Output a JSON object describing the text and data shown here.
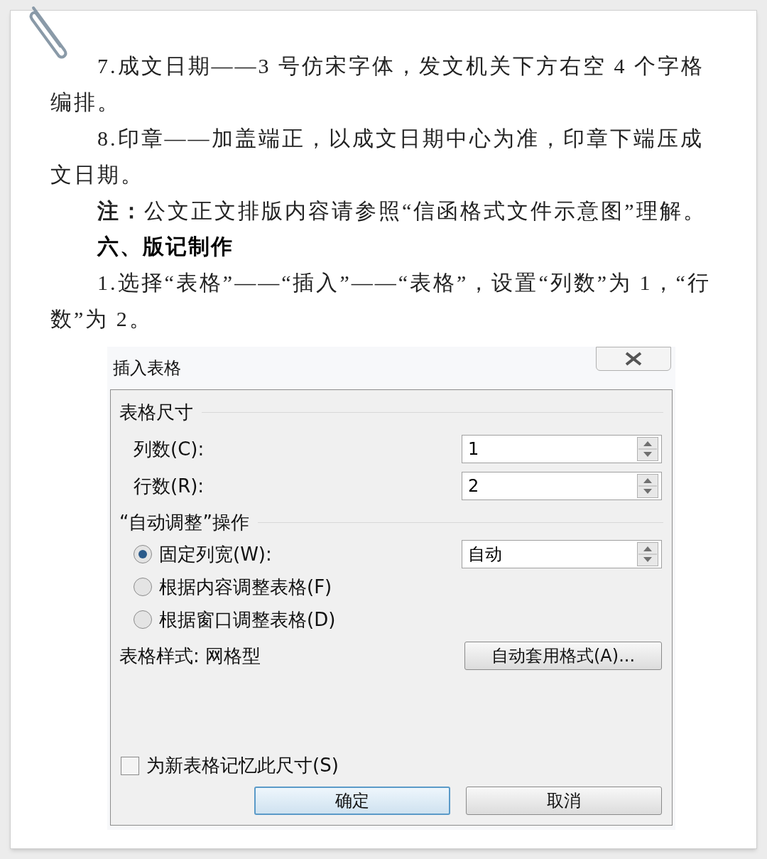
{
  "paragraphs": [
    {
      "kind": "body",
      "text": "7.成文日期——3 号仿宋字体，发文机关下方右空 4 个字格编排。"
    },
    {
      "kind": "body",
      "text": "8.印章——加盖端正，以成文日期中心为准，印章下端压成文日期。"
    },
    {
      "kind": "body",
      "text": "**注：**公文正文排版内容请参照“信函格式文件示意图”理解。"
    },
    {
      "kind": "heading",
      "text": "六、版记制作"
    },
    {
      "kind": "body",
      "text": "1.选择“表格”——“插入”——“表格”，设置“列数”为 1，“行数”为 2。"
    }
  ],
  "dialog": {
    "title": "插入表格",
    "size_group": {
      "title": "表格尺寸",
      "fields": [
        {
          "label": "列数(C):",
          "value": "1"
        },
        {
          "label": "行数(R):",
          "value": "2"
        }
      ]
    },
    "autofit_group": {
      "title": "“自动调整”操作",
      "options": [
        {
          "label": "固定列宽(W):",
          "selected": true,
          "value": "自动"
        },
        {
          "label": "根据内容调整表格(F)",
          "selected": false
        },
        {
          "label": "根据窗口调整表格(D)",
          "selected": false
        }
      ]
    },
    "style_label": "表格样式: 网格型",
    "autoformat_button": "自动套用格式(A)...",
    "remember": {
      "label": "为新表格记忆此尺寸(S)",
      "checked": false
    },
    "buttons": [
      {
        "label": "确定",
        "default": true
      },
      {
        "label": "取消",
        "default": false
      }
    ]
  }
}
